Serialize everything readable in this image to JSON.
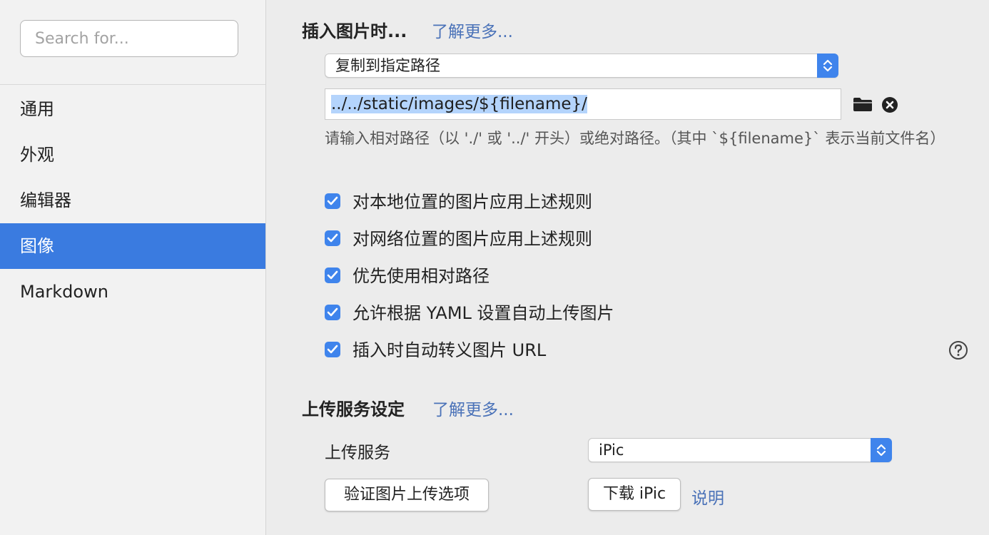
{
  "sidebar": {
    "search_placeholder": "Search for...",
    "items": [
      {
        "label": "通用"
      },
      {
        "label": "外观"
      },
      {
        "label": "编辑器"
      },
      {
        "label": "图像"
      },
      {
        "label": "Markdown"
      }
    ],
    "active_index": 3
  },
  "insert": {
    "title": "插入图片时...",
    "learn_more": "了解更多...",
    "action_value": "复制到指定路径",
    "path_value": "../../static/images/${filename}/",
    "hint": "请输入相对路径（以 './' 或 '../' 开头）或绝对路径。（其中 `${filename}` 表示当前文件名）",
    "checkboxes": [
      {
        "label": "对本地位置的图片应用上述规则",
        "checked": true
      },
      {
        "label": "对网络位置的图片应用上述规则",
        "checked": true
      },
      {
        "label": "优先使用相对路径",
        "checked": true
      },
      {
        "label": "允许根据 YAML 设置自动上传图片",
        "checked": true
      },
      {
        "label": "插入时自动转义图片 URL",
        "checked": true
      }
    ]
  },
  "upload": {
    "title": "上传服务设定",
    "learn_more": "了解更多...",
    "service_label": "上传服务",
    "service_value": "iPic",
    "verify_button": "验证图片上传选项",
    "download_button": "下载 iPic",
    "explain_link": "说明"
  },
  "icons": {
    "folder": "folder-icon",
    "clear": "close-circle-icon",
    "help": "help-icon",
    "stepper": "chevron-up-down-icon",
    "check": "checkmark-icon"
  },
  "colors": {
    "accent": "#3a7be0",
    "link": "#4a72b8",
    "selection": "#b4d4fc"
  }
}
